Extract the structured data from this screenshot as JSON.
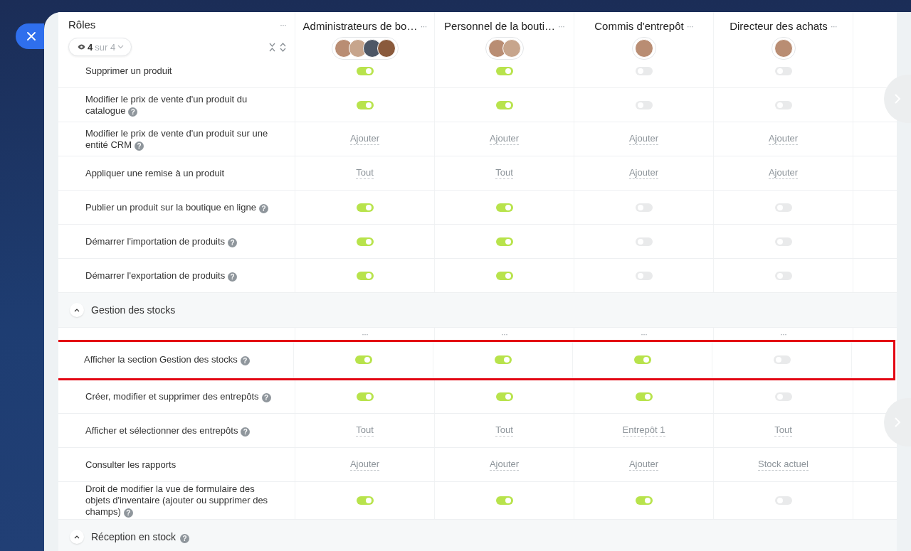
{
  "roles_header": {
    "title": "Rôles",
    "menu": "···",
    "filter": {
      "count": "4",
      "total": "sur 4"
    }
  },
  "columns": [
    {
      "title": "Administrateurs de bo…",
      "menu": "···",
      "avatars": [
        {
          "kind": "photo"
        },
        {
          "kind": "photo"
        },
        {
          "kind": "photo"
        },
        {
          "kind": "photo"
        }
      ]
    },
    {
      "title": "Personnel de la bouti…",
      "menu": "···",
      "avatars": [
        {
          "kind": "photo"
        },
        {
          "kind": "photo"
        }
      ]
    },
    {
      "title": "Commis d'entrepôt",
      "menu": "···",
      "avatars": [
        {
          "kind": "photo"
        }
      ]
    },
    {
      "title": "Directeur des achats",
      "menu": "···",
      "avatars": [
        {
          "kind": "photo"
        }
      ]
    }
  ],
  "rows": [
    {
      "kind": "permission",
      "label": "Supprimer un produit",
      "highlighted": false,
      "cells": [
        {
          "kind": "toggle",
          "on": true
        },
        {
          "kind": "toggle",
          "on": true
        },
        {
          "kind": "toggle",
          "on": false
        },
        {
          "kind": "toggle",
          "on": false
        }
      ]
    },
    {
      "kind": "permission",
      "label": "Modifier le prix de vente d'un produit du catalogue",
      "help": "?",
      "highlighted": false,
      "cells": [
        {
          "kind": "toggle",
          "on": true
        },
        {
          "kind": "toggle",
          "on": true
        },
        {
          "kind": "toggle",
          "on": false
        },
        {
          "kind": "toggle",
          "on": false
        }
      ]
    },
    {
      "kind": "permission",
      "label": "Modifier le prix de vente d'un produit sur une entité CRM",
      "help": "?",
      "highlighted": false,
      "cells": [
        {
          "kind": "link",
          "text": "Ajouter"
        },
        {
          "kind": "link",
          "text": "Ajouter"
        },
        {
          "kind": "link",
          "text": "Ajouter"
        },
        {
          "kind": "link",
          "text": "Ajouter"
        }
      ]
    },
    {
      "kind": "permission",
      "label": "Appliquer une remise à un produit",
      "highlighted": false,
      "cells": [
        {
          "kind": "link",
          "text": "Tout"
        },
        {
          "kind": "link",
          "text": "Tout"
        },
        {
          "kind": "link",
          "text": "Ajouter"
        },
        {
          "kind": "link",
          "text": "Ajouter"
        }
      ]
    },
    {
      "kind": "permission",
      "label": "Publier un produit sur la boutique en ligne",
      "help": "?",
      "highlighted": false,
      "cells": [
        {
          "kind": "toggle",
          "on": true
        },
        {
          "kind": "toggle",
          "on": true
        },
        {
          "kind": "toggle",
          "on": false
        },
        {
          "kind": "toggle",
          "on": false
        }
      ]
    },
    {
      "kind": "permission",
      "label": "Démarrer l'importation de produits",
      "help": "?",
      "highlighted": false,
      "cells": [
        {
          "kind": "toggle",
          "on": true
        },
        {
          "kind": "toggle",
          "on": true
        },
        {
          "kind": "toggle",
          "on": false
        },
        {
          "kind": "toggle",
          "on": false
        }
      ]
    },
    {
      "kind": "permission",
      "label": "Démarrer l'exportation de produits",
      "help": "?",
      "highlighted": false,
      "cells": [
        {
          "kind": "toggle",
          "on": true
        },
        {
          "kind": "toggle",
          "on": true
        },
        {
          "kind": "toggle",
          "on": false
        },
        {
          "kind": "toggle",
          "on": false
        }
      ]
    },
    {
      "kind": "section",
      "label": "Gestion des stocks",
      "expanded": true
    },
    {
      "kind": "menus",
      "cells": [
        "···",
        "···",
        "···",
        "···"
      ]
    },
    {
      "kind": "permission",
      "label": "Afficher la section Gestion des stocks",
      "help": "?",
      "highlighted": true,
      "cells": [
        {
          "kind": "toggle",
          "on": true
        },
        {
          "kind": "toggle",
          "on": true
        },
        {
          "kind": "toggle",
          "on": true
        },
        {
          "kind": "toggle",
          "on": false
        }
      ]
    },
    {
      "kind": "permission",
      "label": "Créer, modifier et supprimer des entrepôts",
      "help": "?",
      "highlighted": false,
      "cells": [
        {
          "kind": "toggle",
          "on": true
        },
        {
          "kind": "toggle",
          "on": true
        },
        {
          "kind": "toggle",
          "on": true
        },
        {
          "kind": "toggle",
          "on": false
        }
      ]
    },
    {
      "kind": "permission",
      "label": "Afficher et sélectionner des entrepôts",
      "help": "?",
      "highlighted": false,
      "cells": [
        {
          "kind": "link",
          "text": "Tout"
        },
        {
          "kind": "link",
          "text": "Tout"
        },
        {
          "kind": "link",
          "text": "Entrepôt 1"
        },
        {
          "kind": "link",
          "text": "Tout"
        }
      ]
    },
    {
      "kind": "permission",
      "label": "Consulter les rapports",
      "highlighted": false,
      "cells": [
        {
          "kind": "link",
          "text": "Ajouter"
        },
        {
          "kind": "link",
          "text": "Ajouter"
        },
        {
          "kind": "link",
          "text": "Ajouter"
        },
        {
          "kind": "link",
          "text": "Stock actuel"
        }
      ]
    },
    {
      "kind": "permission",
      "label": "Droit de modifier la vue de formulaire des objets d'inventaire (ajouter ou supprimer des champs)",
      "help": "?",
      "highlighted": false,
      "cells": [
        {
          "kind": "toggle",
          "on": true
        },
        {
          "kind": "toggle",
          "on": true
        },
        {
          "kind": "toggle",
          "on": true
        },
        {
          "kind": "toggle",
          "on": false
        }
      ]
    },
    {
      "kind": "section",
      "label": "Réception en stock",
      "help": "?",
      "expanded": true
    }
  ]
}
